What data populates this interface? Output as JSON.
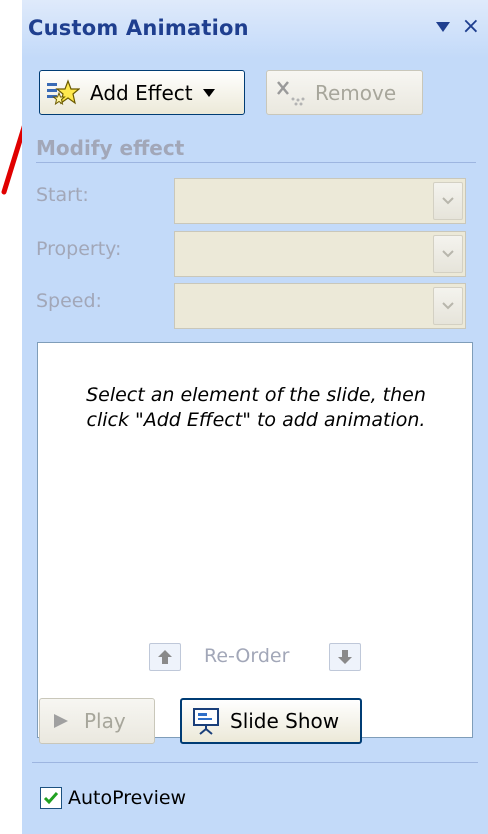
{
  "pane": {
    "title": "Custom Animation",
    "close_glyph": "×"
  },
  "toolbar": {
    "add_effect_label": "Add Effect",
    "remove_label": "Remove"
  },
  "modify": {
    "heading": "Modify effect",
    "start_label": "Start:",
    "property_label": "Property:",
    "speed_label": "Speed:",
    "start_value": "",
    "property_value": "",
    "speed_value": ""
  },
  "list": {
    "hint_line1": "Select an element of the slide, then",
    "hint_line2": "click \"Add Effect\" to add animation."
  },
  "reorder": {
    "label": "Re-Order"
  },
  "playback": {
    "play_label": "Play",
    "slideshow_label": "Slide Show"
  },
  "autopreview": {
    "label": "AutoPreview",
    "checked": true
  },
  "colors": {
    "pane_background": "#c3daf9",
    "title_text": "#1f3f8f",
    "annotation_arrow": "#e00000",
    "disabled_text": "#a2a7b8",
    "checkmark": "#21a121"
  },
  "icons": {
    "add_effect": "star-effect-icon",
    "remove": "remove-x-icon",
    "reorder_up": "arrow-up-icon",
    "reorder_down": "arrow-down-icon",
    "play": "play-triangle-icon",
    "slideshow": "projector-screen-icon",
    "checkbox": "checkmark-icon"
  }
}
